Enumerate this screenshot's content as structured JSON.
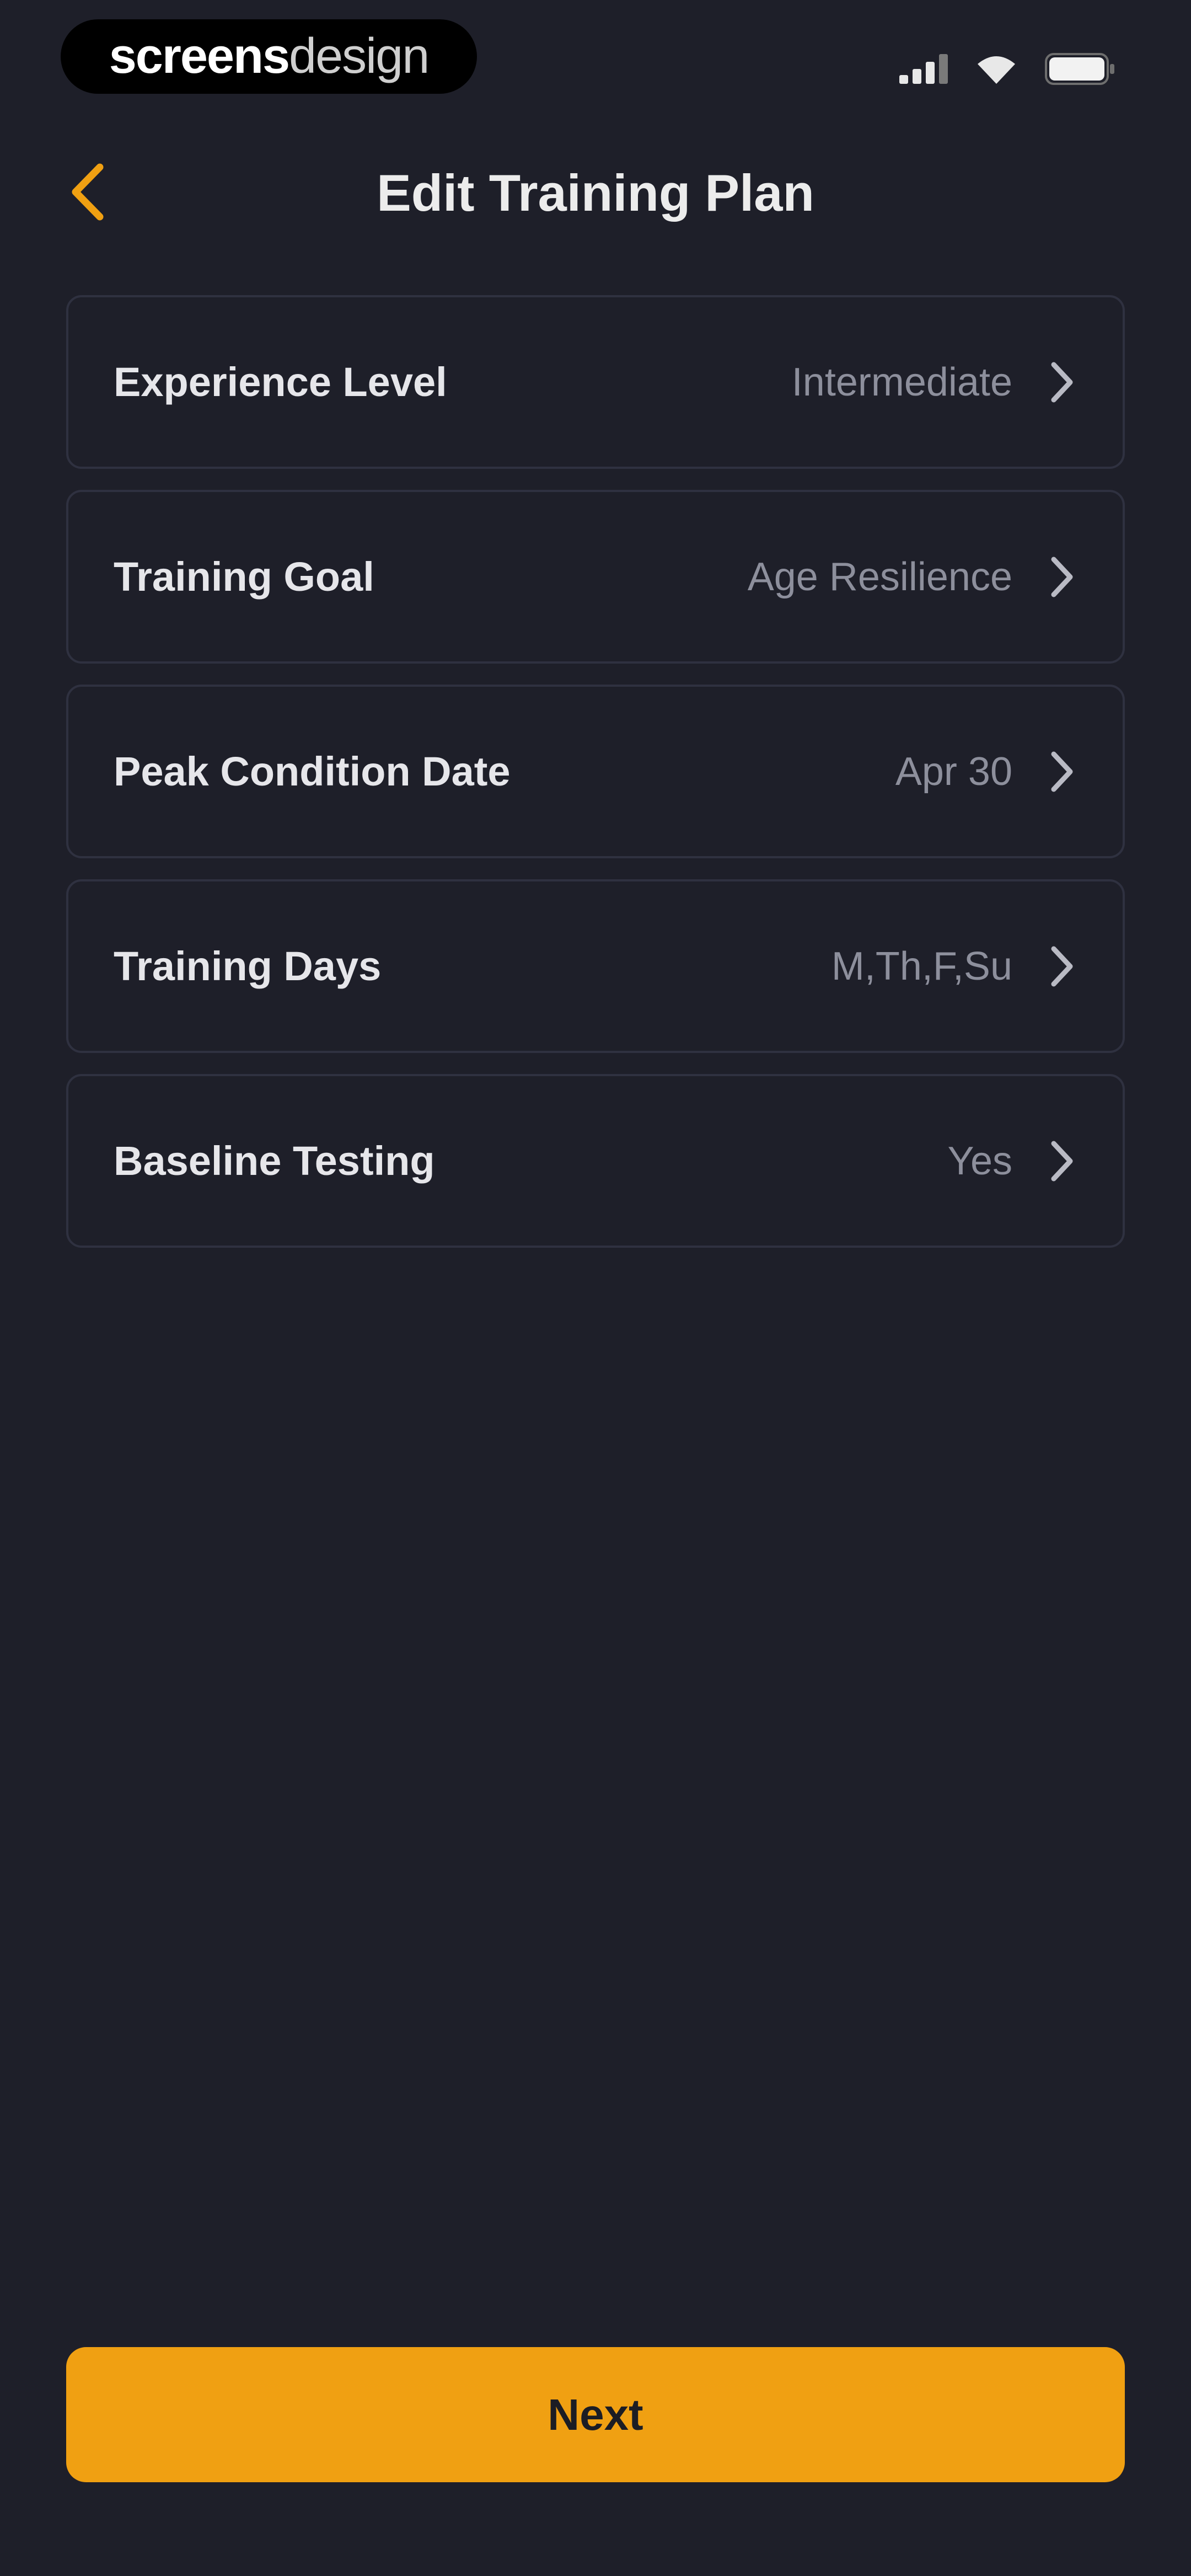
{
  "status_bar": {
    "brand_part1": "screens",
    "brand_part2": "design",
    "icons": [
      "signal-icon",
      "wifi-icon",
      "battery-icon"
    ]
  },
  "header": {
    "title": "Edit Training Plan",
    "back_icon": "chevron-left-icon"
  },
  "colors": {
    "background": "#1e1f29",
    "accent": "#f0a012",
    "row_border": "#2f3140",
    "value_text": "#8d8f9c"
  },
  "settings": [
    {
      "label": "Experience Level",
      "value": "Intermediate"
    },
    {
      "label": "Training Goal",
      "value": "Age Resilience"
    },
    {
      "label": "Peak Condition Date",
      "value": "Apr 30"
    },
    {
      "label": "Training Days",
      "value": "M,Th,F,Su"
    },
    {
      "label": "Baseline Testing",
      "value": "Yes"
    }
  ],
  "footer": {
    "next_label": "Next"
  }
}
